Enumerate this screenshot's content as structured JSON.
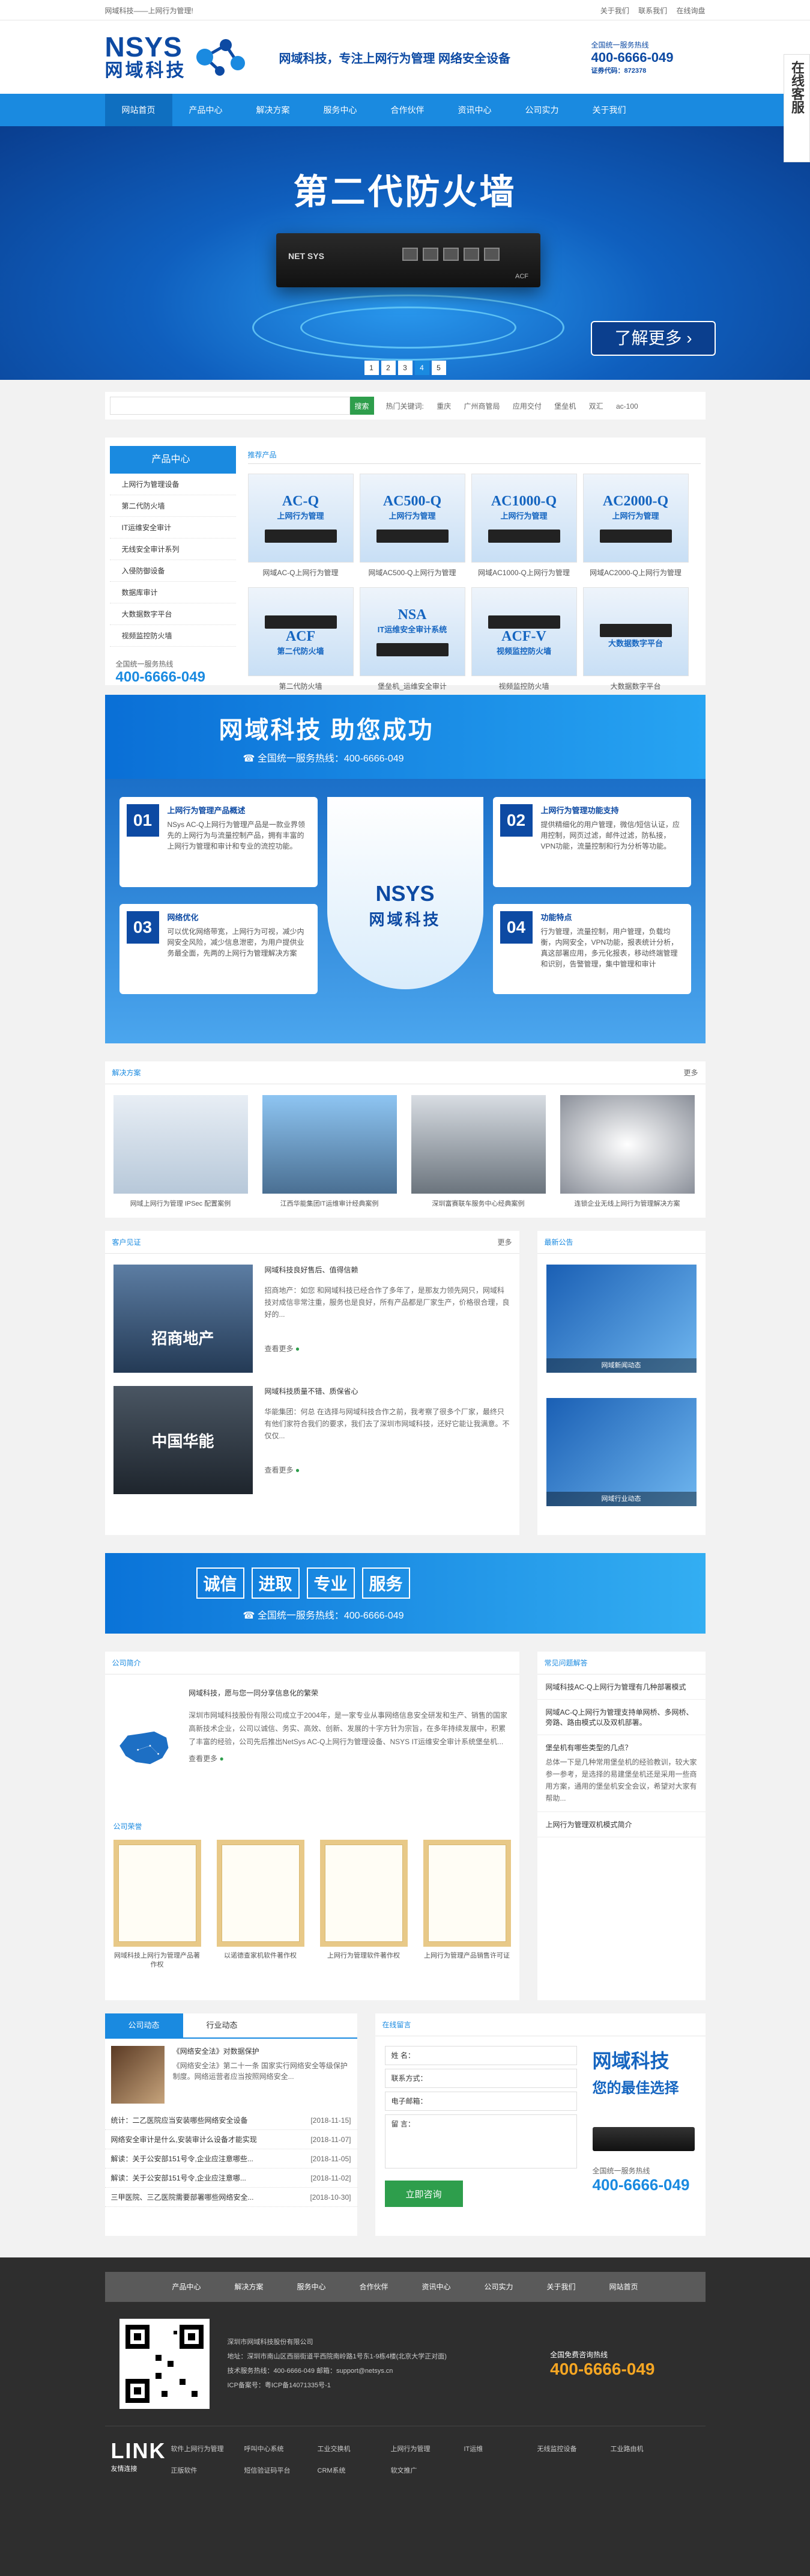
{
  "topbar": {
    "welcome": "网域科技——上网行为管理!",
    "links": [
      "关于我们",
      "联系我们",
      "在线询盘"
    ]
  },
  "header": {
    "logo_en": "NSYS",
    "logo_cn": "网域科技",
    "slogan": "网域科技，专注上网行为管理 网络安全设备",
    "hotline_label": "全国统一服务热线",
    "hotline": "400-6666-049",
    "cert": "证券代码：872378"
  },
  "nav": [
    "网站首页",
    "产品中心",
    "解决方案",
    "服务中心",
    "合作伙伴",
    "资讯中心",
    "公司实力",
    "关于我们"
  ],
  "banner": {
    "title": "第二代防火墙",
    "device_brand": "NET SYS",
    "device_model": "ACF",
    "button": "了解更多",
    "pages": [
      "1",
      "2",
      "3",
      "4",
      "5"
    ],
    "active_page": 4
  },
  "search": {
    "placeholder": "",
    "button": "搜索",
    "hot_label": "热门关键词:",
    "keywords": [
      "重庆",
      "广州商管局",
      "应用交付",
      "堡垒机",
      "双汇",
      "ac-100"
    ]
  },
  "products": {
    "side_title": "产品中心",
    "side_items": [
      "上网行为管理设备",
      "第二代防火墙",
      "IT运维安全审计",
      "无线安全审计系列",
      "入侵防御设备",
      "数据库审计",
      "大数据数字平台",
      "视频监控防火墙"
    ],
    "hot_label": "全国统一服务热线",
    "hot_number": "400-6666-049",
    "tab": "推荐产品",
    "items": [
      {
        "title": "AC-Q",
        "sub": "上网行为管理",
        "caption": "网域AC-Q上网行为管理"
      },
      {
        "title": "AC500-Q",
        "sub": "上网行为管理",
        "caption": "网域AC500-Q上网行为管理"
      },
      {
        "title": "AC1000-Q",
        "sub": "上网行为管理",
        "caption": "网域AC1000-Q上网行为管理"
      },
      {
        "title": "AC2000-Q",
        "sub": "上网行为管理",
        "caption": "网域AC2000-Q上网行为管理"
      },
      {
        "title": "ACF",
        "sub": "第二代防火墙",
        "caption": "第二代防火墙"
      },
      {
        "title": "NSA",
        "sub": "IT运维安全审计系统",
        "caption": "堡垒机_运维安全审计"
      },
      {
        "title": "ACF-V",
        "sub": "视频监控防火墙",
        "caption": "视频监控防火墙"
      },
      {
        "title": "",
        "sub": "大数据数字平台",
        "caption": "大数据数字平台"
      }
    ]
  },
  "help": {
    "title": "网域科技  助您成功",
    "tel": "全国统一服务热线：400-6666-049"
  },
  "features": {
    "shield_en": "NSYS",
    "shield_cn": "网域科技",
    "items": [
      {
        "num": "01",
        "title": "上网行为管理产品概述",
        "desc": "NSys AC-Q上网行为管理产品是一款业界领先的上网行为与流量控制产品，拥有丰富的上网行为管理和审计和专业的流控功能。"
      },
      {
        "num": "02",
        "title": "上网行为管理功能支持",
        "desc": "提供精细化的用户管理，微信/短信认证，应用控制，网页过滤，邮件过滤，防私接，VPN功能，流量控制和行为分析等功能。"
      },
      {
        "num": "03",
        "title": "网络优化",
        "desc": "可以优化网络带宽，上网行为可视，减少内网安全风险，减少信息泄密，为用户提供业务最全面，先两的上网行为管理解决方案"
      },
      {
        "num": "04",
        "title": "功能特点",
        "desc": "行为管理，流量控制，用户管理，负载均衡，内网安全，VPN功能，报表统计分析，真这部署应用，多元化报表，移动终端管理和识别，告警管理，集中管理和审计"
      }
    ]
  },
  "solutions": {
    "title": "解决方案",
    "more": "更多",
    "items": [
      "网域上网行为管理 IPSec 配置案例",
      "江西华能集团IT运维审计经典案例",
      "深圳富赛联车服务中心经典案例",
      "连锁企业无线上网行为管理解决方案"
    ]
  },
  "cases": {
    "title": "客户见证",
    "more": "更多",
    "items": [
      {
        "img_label": "招商地产",
        "title": "网域科技良好售后、值得信赖",
        "desc": "招商地产：如您 和网域科技已经合作了多年了，是那友力领先网只，网域科技对成信非常注重，服务也是良好，所有产品都是厂家生产，价格很合理，良好的...",
        "more": "查看更多"
      },
      {
        "img_label": "中国华能",
        "title": "网域科技质量不错、质保省心",
        "desc": "华能集团：何总 在选择与网域科技合作之前，我考察了很多个厂家，最终只有他们家符合我们的要求，我们去了深圳市网域科技，还好它能让我满意。不仅仅...",
        "more": "查看更多"
      }
    ]
  },
  "news_side": {
    "title": "最新公告",
    "items": [
      "网域新闻动态",
      "网域行业动态"
    ]
  },
  "service": {
    "words": [
      "诚信",
      "进取",
      "专业",
      "服务"
    ],
    "tel": "全国统一服务热线：400-6666-049"
  },
  "about": {
    "title": "公司简介",
    "heading": "网域科技，愿与您一同分享信息化的繁荣",
    "desc": "深圳市网域科技股份有限公司成立于2004年，是一家专业从事网络信息安全研发和生产、销售的国家高新技术企业，公司以诚信、务实、高效、创新、发展的十字方针为宗旨，在多年持续发展中，积累了丰富的经验，公司先后推出NetSys AC-Q上网行为管理设备、NSYS IT运维安全审计系统堡垒机...",
    "more": "查看更多",
    "honor_title": "公司荣誉",
    "honors": [
      "网域科技上网行为管理产品著作权",
      "以诺德查家机软件著作权",
      "上网行为管理软件著作权",
      "上网行为管理产品销售许可证"
    ]
  },
  "faq": {
    "title": "常见问题解答",
    "items": [
      {
        "q": "网域科技AC-Q上网行为管理有几种部署模式",
        "a": ""
      },
      {
        "q": "网域AC-Q上网行为管理支持单网桥、多网桥、旁路、路由模式以及双机部署。",
        "a": ""
      },
      {
        "q": "堡垒机有哪些类型的几点？",
        "a": "总体一下是几种常用堡垒机的经验教训，较大家参一参考，是选择的易建堡垒机还是采用一些商用方案，通用的堡垒机安全会议，希望对大家有帮助..."
      },
      {
        "q": "上网行为管理双机模式简介",
        "a": ""
      }
    ]
  },
  "news2": {
    "tabs": [
      "公司动态",
      "行业动态"
    ],
    "top_title": "《网络安全法》对数据保护",
    "top_desc": "《网络安全法》第二十一条 国家实行网络安全等级保护制度。网络运营者应当按照网络安全...",
    "list": [
      {
        "t": "统计：二乙医院应当安装哪些网络安全设备",
        "d": "[2018-11-15]"
      },
      {
        "t": "网络安全审计是什么,安装审计么设备才能实现",
        "d": "[2018-11-07]"
      },
      {
        "t": "解读：关于公安部151号令,企业应注意哪些...",
        "d": "[2018-11-05]"
      },
      {
        "t": "解读：关于公安部151号令,企业应注意哪...",
        "d": "[2018-11-02]"
      },
      {
        "t": "三甲医院、三乙医院需要部署哪些网络安全...",
        "d": "[2018-10-30]"
      }
    ]
  },
  "message": {
    "title": "在线留言",
    "fields": [
      "姓    名：",
      "联系方式：",
      "电子邮箱：",
      "留    言："
    ],
    "submit": "立即咨询",
    "brand1": "网域科技",
    "brand2": "您的最佳选择",
    "hot_label": "全国统一服务热线",
    "hot_number": "400-6666-049"
  },
  "footer": {
    "nav": [
      "产品中心",
      "解决方案",
      "服务中心",
      "合作伙伴",
      "资讯中心",
      "公司实力",
      "关于我们",
      "网站首页"
    ],
    "company": "深圳市网域科技股份有限公司",
    "address": "地址：深圳市南山区西丽街道平西院南岭路1号东1-9栋4楼(北京大学正对面)",
    "phone": "技术服务热线：400-6666-049  邮箱：support@netsys.cn",
    "icp": "ICP备案号：粤ICP备14071335号-1",
    "hot_label": "全国免费咨询热线",
    "hot_number": "400-6666-049",
    "link_title": "LINK",
    "link_sub": "友情连接",
    "links": [
      "软件上网行为管理",
      "呼叫中心系统",
      "工业交换机",
      "上网行为管理",
      "IT运维",
      "无线监控设备",
      "工业路由机",
      "正版软件",
      "短信验证码平台",
      "CRM系统",
      "软文推广"
    ]
  },
  "widget": {
    "label": "在线客服"
  }
}
